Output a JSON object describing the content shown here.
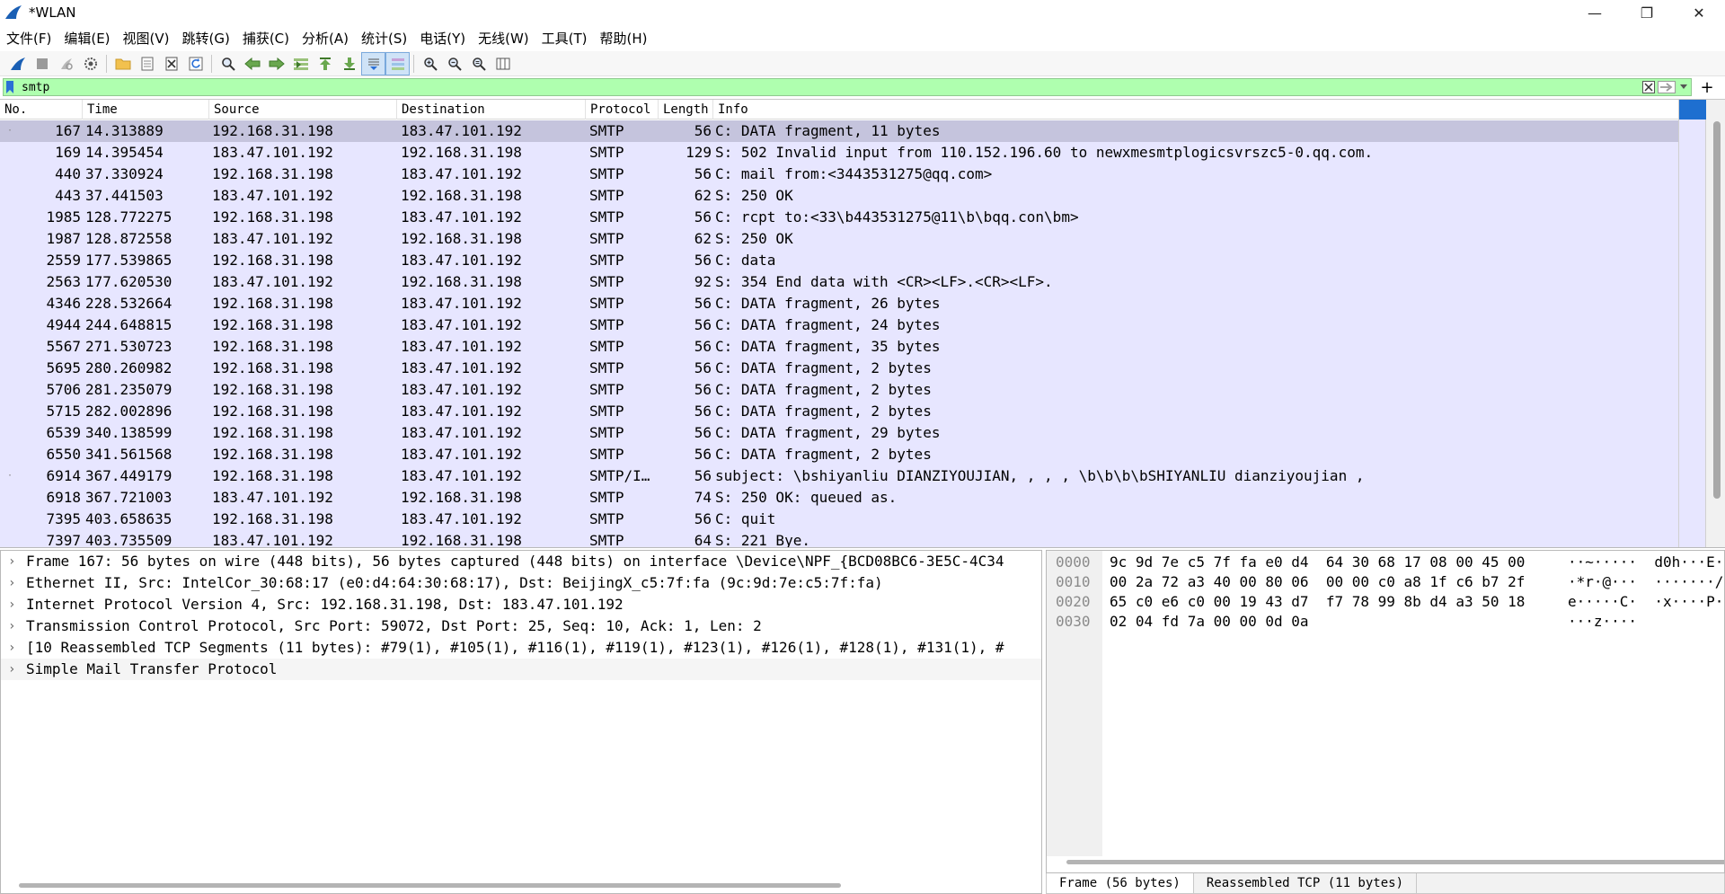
{
  "window": {
    "title": "*WLAN",
    "minimize": "—",
    "restore": "❐",
    "close": "✕"
  },
  "menu": [
    "文件(F)",
    "编辑(E)",
    "视图(V)",
    "跳转(G)",
    "捕获(C)",
    "分析(A)",
    "统计(S)",
    "电话(Y)",
    "无线(W)",
    "工具(T)",
    "帮助(H)"
  ],
  "filter": {
    "value": "smtp"
  },
  "packet_list": {
    "columns": [
      "No.",
      "Time",
      "Source",
      "Destination",
      "Protocol",
      "Length",
      "Info"
    ],
    "rows": [
      {
        "no": "167",
        "time": "14.313889",
        "src": "192.168.31.198",
        "dst": "183.47.101.192",
        "proto": "SMTP",
        "len": "56",
        "info": "C: DATA fragment, 11 bytes"
      },
      {
        "no": "169",
        "time": "14.395454",
        "src": "183.47.101.192",
        "dst": "192.168.31.198",
        "proto": "SMTP",
        "len": "129",
        "info": "S: 502 Invalid input from 110.152.196.60 to newxmesmtplogicsvrszc5-0.qq.com."
      },
      {
        "no": "440",
        "time": "37.330924",
        "src": "192.168.31.198",
        "dst": "183.47.101.192",
        "proto": "SMTP",
        "len": "56",
        "info": "C: mail from:<3443531275@qq.com>"
      },
      {
        "no": "443",
        "time": "37.441503",
        "src": "183.47.101.192",
        "dst": "192.168.31.198",
        "proto": "SMTP",
        "len": "62",
        "info": "S: 250 OK"
      },
      {
        "no": "1985",
        "time": "128.772275",
        "src": "192.168.31.198",
        "dst": "183.47.101.192",
        "proto": "SMTP",
        "len": "56",
        "info": "C: rcpt to:<33\\b443531275@11\\b\\bqq.con\\bm>"
      },
      {
        "no": "1987",
        "time": "128.872558",
        "src": "183.47.101.192",
        "dst": "192.168.31.198",
        "proto": "SMTP",
        "len": "62",
        "info": "S: 250 OK"
      },
      {
        "no": "2559",
        "time": "177.539865",
        "src": "192.168.31.198",
        "dst": "183.47.101.192",
        "proto": "SMTP",
        "len": "56",
        "info": "C: data"
      },
      {
        "no": "2563",
        "time": "177.620530",
        "src": "183.47.101.192",
        "dst": "192.168.31.198",
        "proto": "SMTP",
        "len": "92",
        "info": "S: 354 End data with <CR><LF>.<CR><LF>."
      },
      {
        "no": "4346",
        "time": "228.532664",
        "src": "192.168.31.198",
        "dst": "183.47.101.192",
        "proto": "SMTP",
        "len": "56",
        "info": "C: DATA fragment, 26 bytes"
      },
      {
        "no": "4944",
        "time": "244.648815",
        "src": "192.168.31.198",
        "dst": "183.47.101.192",
        "proto": "SMTP",
        "len": "56",
        "info": "C: DATA fragment, 24 bytes"
      },
      {
        "no": "5567",
        "time": "271.530723",
        "src": "192.168.31.198",
        "dst": "183.47.101.192",
        "proto": "SMTP",
        "len": "56",
        "info": "C: DATA fragment, 35 bytes"
      },
      {
        "no": "5695",
        "time": "280.260982",
        "src": "192.168.31.198",
        "dst": "183.47.101.192",
        "proto": "SMTP",
        "len": "56",
        "info": "C: DATA fragment, 2 bytes"
      },
      {
        "no": "5706",
        "time": "281.235079",
        "src": "192.168.31.198",
        "dst": "183.47.101.192",
        "proto": "SMTP",
        "len": "56",
        "info": "C: DATA fragment, 2 bytes"
      },
      {
        "no": "5715",
        "time": "282.002896",
        "src": "192.168.31.198",
        "dst": "183.47.101.192",
        "proto": "SMTP",
        "len": "56",
        "info": "C: DATA fragment, 2 bytes"
      },
      {
        "no": "6539",
        "time": "340.138599",
        "src": "192.168.31.198",
        "dst": "183.47.101.192",
        "proto": "SMTP",
        "len": "56",
        "info": "C: DATA fragment, 29 bytes"
      },
      {
        "no": "6550",
        "time": "341.561568",
        "src": "192.168.31.198",
        "dst": "183.47.101.192",
        "proto": "SMTP",
        "len": "56",
        "info": "C: DATA fragment, 2 bytes"
      },
      {
        "no": "6914",
        "time": "367.449179",
        "src": "192.168.31.198",
        "dst": "183.47.101.192",
        "proto": "SMTP/I…",
        "len": "56",
        "info": "subject: \\bshiyanliu DIANZIYOUJIAN, ,   ,   , \\b\\b\\b\\bSHIYANLIU dianziyoujian  ,"
      },
      {
        "no": "6918",
        "time": "367.721003",
        "src": "183.47.101.192",
        "dst": "192.168.31.198",
        "proto": "SMTP",
        "len": "74",
        "info": "S: 250 OK: queued as."
      },
      {
        "no": "7395",
        "time": "403.658635",
        "src": "192.168.31.198",
        "dst": "183.47.101.192",
        "proto": "SMTP",
        "len": "56",
        "info": "C: quit"
      },
      {
        "no": "7397",
        "time": "403.735509",
        "src": "183.47.101.192",
        "dst": "192.168.31.198",
        "proto": "SMTP",
        "len": "64",
        "info": "S: 221 Bye."
      }
    ]
  },
  "details": [
    "Frame 167: 56 bytes on wire (448 bits), 56 bytes captured (448 bits) on interface \\Device\\NPF_{BCD08BC6-3E5C-4C34",
    "Ethernet II, Src: IntelCor_30:68:17 (e0:d4:64:30:68:17), Dst: BeijingX_c5:7f:fa (9c:9d:7e:c5:7f:fa)",
    "Internet Protocol Version 4, Src: 192.168.31.198, Dst: 183.47.101.192",
    "Transmission Control Protocol, Src Port: 59072, Dst Port: 25, Seq: 10, Ack: 1, Len: 2",
    "[10 Reassembled TCP Segments (11 bytes): #79(1), #105(1), #116(1), #119(1), #123(1), #126(1), #128(1), #131(1), #",
    "Simple Mail Transfer Protocol"
  ],
  "bytes": {
    "rows": [
      {
        "offset": "0000",
        "hex": "9c 9d 7e c5 7f fa e0 d4  64 30 68 17 08 00 45 00",
        "ascii": "··~·····  d0h···E·"
      },
      {
        "offset": "0010",
        "hex": "00 2a 72 a3 40 00 80 06  00 00 c0 a8 1f c6 b7 2f",
        "ascii": "·*r·@···  ·······/"
      },
      {
        "offset": "0020",
        "hex": "65 c0 e6 c0 00 19 43 d7  f7 78 99 8b d4 a3 50 18",
        "ascii": "e·····C·  ·x····P·"
      },
      {
        "offset": "0030",
        "hex": "02 04 fd 7a 00 00 0d 0a",
        "ascii": "···z····"
      }
    ],
    "tabs": [
      "Frame (56 bytes)",
      "Reassembled TCP (11 bytes)"
    ]
  },
  "colors": {
    "row_bg": "#e7e6ff",
    "row_selected_bg": "#c5c4dd",
    "filter_bg": "#afffaf",
    "minimap_thumb": "#1e6fd0"
  }
}
